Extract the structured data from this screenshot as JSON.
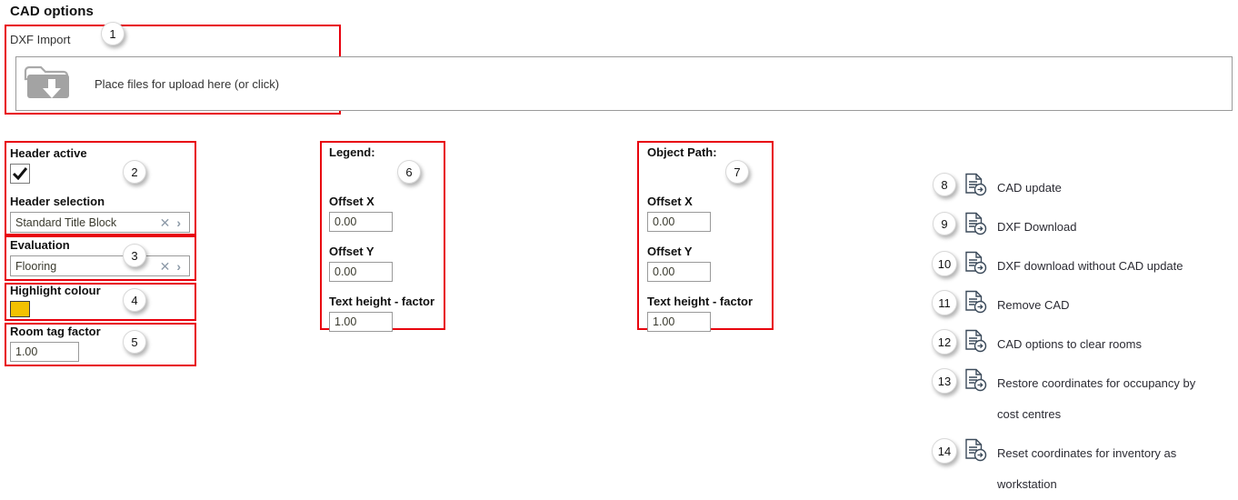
{
  "page": {
    "title": "CAD options"
  },
  "dxf_import": {
    "label": "DXF Import",
    "dropzone_text": "Place files for upload here (or click)",
    "folder_icon": "folder-download-icon"
  },
  "header_panel": {
    "active_label": "Header active",
    "checked": true,
    "check_icon": "checkmark-icon",
    "selection_label": "Header selection",
    "selection_value": "Standard Title Block",
    "clear_icon": "clear-x-icon",
    "expand_icon": "chevron-right-icon"
  },
  "evaluation_panel": {
    "label": "Evaluation",
    "value": "Flooring",
    "clear_icon": "clear-x-icon",
    "expand_icon": "chevron-right-icon"
  },
  "highlight_panel": {
    "label": "Highlight colour",
    "colour": "#f3c100",
    "swatch_icon": "colour-swatch"
  },
  "room_tag_panel": {
    "label": "Room tag factor",
    "value": "1.00"
  },
  "legend_group": {
    "title": "Legend:",
    "offset_x_label": "Offset X",
    "offset_x_value": "0.00",
    "offset_y_label": "Offset Y",
    "offset_y_value": "0.00",
    "text_height_label": "Text height - factor",
    "text_height_value": "1.00"
  },
  "object_path_group": {
    "title": "Object Path:",
    "offset_x_label": "Offset X",
    "offset_x_value": "0.00",
    "offset_y_label": "Offset Y",
    "offset_y_value": "0.00",
    "text_height_label": "Text height - factor",
    "text_height_value": "1.00"
  },
  "actions": {
    "icon": "document-action-icon",
    "items": [
      {
        "badge": "8",
        "label": "CAD update"
      },
      {
        "badge": "9",
        "label": "DXF Download"
      },
      {
        "badge": "10",
        "label": "DXF download without CAD update"
      },
      {
        "badge": "11",
        "label": "Remove CAD"
      },
      {
        "badge": "12",
        "label": "CAD options to clear rooms"
      },
      {
        "badge": "13",
        "label": "Restore coordinates for occupancy by cost centres"
      },
      {
        "badge": "14",
        "label": "Reset coordinates for inventory as workstation"
      }
    ]
  },
  "annotations": {
    "badges": [
      {
        "n": "1"
      },
      {
        "n": "2"
      },
      {
        "n": "3"
      },
      {
        "n": "4"
      },
      {
        "n": "5"
      },
      {
        "n": "6"
      },
      {
        "n": "7"
      }
    ],
    "box_colour": "#e8000d"
  }
}
